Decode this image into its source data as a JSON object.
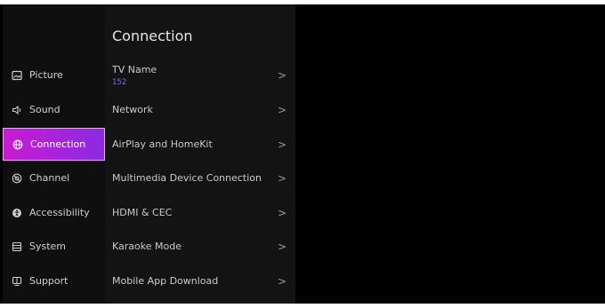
{
  "sidebar": {
    "items": [
      {
        "label": "Picture",
        "icon": "picture-icon"
      },
      {
        "label": "Sound",
        "icon": "sound-icon"
      },
      {
        "label": "Connection",
        "icon": "globe-icon",
        "active": true
      },
      {
        "label": "Channel",
        "icon": "channel-icon"
      },
      {
        "label": "Accessibility",
        "icon": "accessibility-icon"
      },
      {
        "label": "System",
        "icon": "system-icon"
      },
      {
        "label": "Support",
        "icon": "support-icon"
      }
    ]
  },
  "detail": {
    "title": "Connection",
    "rows": [
      {
        "label": "TV Name",
        "value": "152"
      },
      {
        "label": "Network"
      },
      {
        "label": "AirPlay and HomeKit"
      },
      {
        "label": "Multimedia Device Connection"
      },
      {
        "label": "HDMI & CEC"
      },
      {
        "label": "Karaoke Mode"
      },
      {
        "label": "Mobile App Download"
      }
    ],
    "chevron": ">"
  },
  "colors": {
    "active_gradient_start": "#c81bd1",
    "active_gradient_end": "#8a2be2",
    "accent_value": "#7d6bd6"
  }
}
